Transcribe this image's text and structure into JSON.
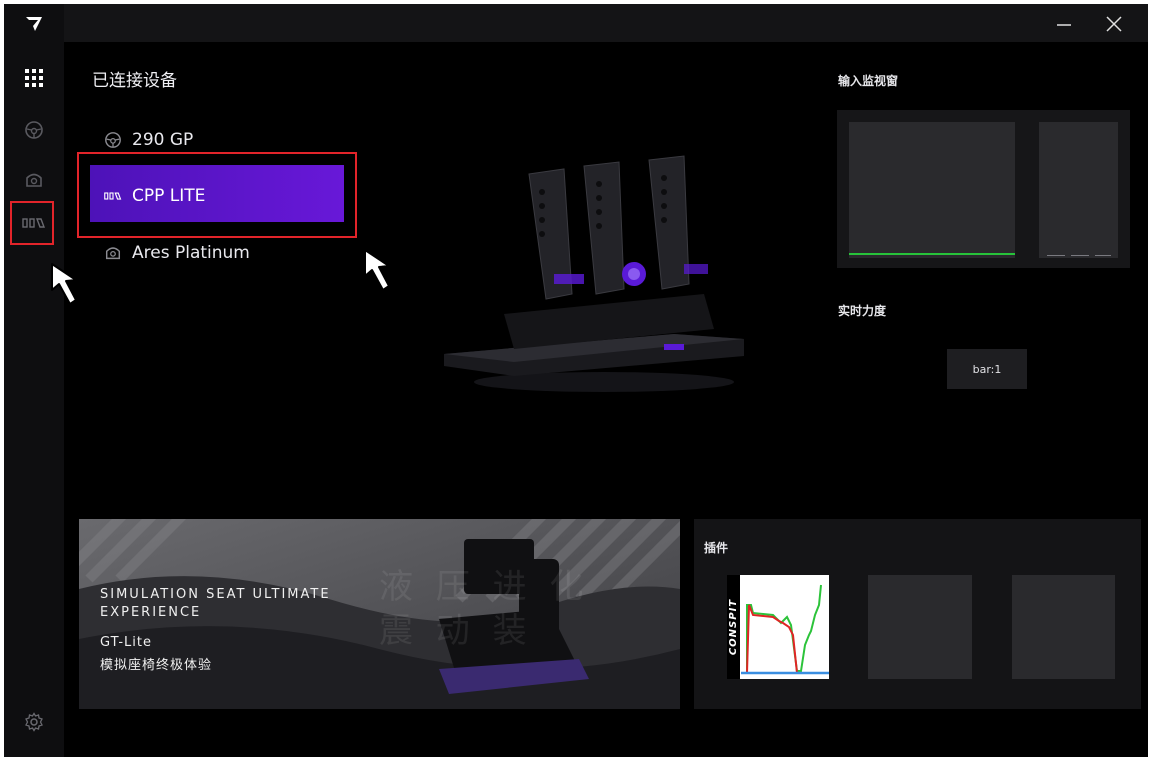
{
  "header": {
    "connected_title": "已连接设备",
    "input_monitor_title": "输入监视窗",
    "realtime_force_title": "实时力度",
    "plugins_title": "插件"
  },
  "devices": [
    {
      "label": "290 GP",
      "icon": "steering-wheel-icon",
      "selected": false
    },
    {
      "label": "CPP LITE",
      "icon": "pedals-icon",
      "selected": true
    },
    {
      "label": "Ares Platinum",
      "icon": "wheelbase-icon",
      "selected": false
    }
  ],
  "force": {
    "bar_label": "bar:1"
  },
  "banner": {
    "line1": "SIMULATION SEAT  ULTIMATE",
    "line2": "EXPERIENCE",
    "product": "GT-Lite",
    "subtitle": "模拟座椅终极体验",
    "watermark_row1": "液 压 进 化",
    "watermark_row2": "震 动 装"
  },
  "plugin_card": {
    "brand": "CONSPIT"
  },
  "sidebar_icons": [
    "logo-icon",
    "apps-grid-icon",
    "steering-wheel-icon",
    "wheelbase-icon",
    "pedals-icon",
    "settings-icon"
  ],
  "colors": {
    "accent_purple": "#5a1ad8",
    "monitor_green": "#27c33a",
    "annotation_red": "#e2242a"
  }
}
